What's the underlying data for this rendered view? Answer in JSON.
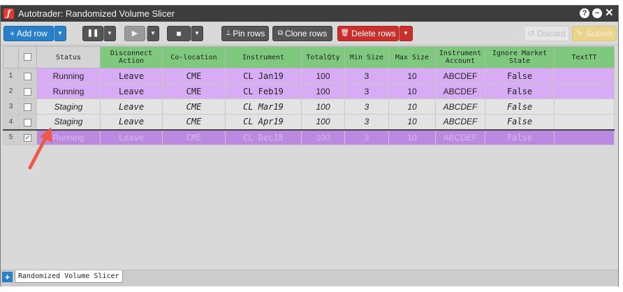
{
  "window": {
    "title": "Autotrader: Randomized Volume Slicer"
  },
  "titlebar": {
    "help_icon": "?",
    "minimize_icon": "−",
    "close_icon": "✕"
  },
  "toolbar": {
    "add_row": "+ Add row",
    "pin_rows": "Pin rows",
    "clone_rows": "Clone rows",
    "delete_rows": "Delete rows",
    "discard": "Discard",
    "submit": "Submit"
  },
  "grid": {
    "columns": [
      "Status",
      "Disconnect Action",
      "Co-location",
      "Instrument",
      "TotalQty",
      "Min Size",
      "Max Size",
      "Instrument Account",
      "Ignore Market State",
      "TextTT"
    ],
    "rows": [
      {
        "num": "1",
        "checked": "",
        "status": "Running",
        "disconnect": "Leave",
        "colocation": "CME",
        "instrument": "CL Jan19",
        "totalqty": "100",
        "min": "3",
        "max": "10",
        "account": "ABCDEF",
        "ignore": "False",
        "text": ""
      },
      {
        "num": "2",
        "checked": "",
        "status": "Running",
        "disconnect": "Leave",
        "colocation": "CME",
        "instrument": "CL Feb19",
        "totalqty": "100",
        "min": "3",
        "max": "10",
        "account": "ABCDEF",
        "ignore": "False",
        "text": ""
      },
      {
        "num": "3",
        "checked": "",
        "status": "Staging",
        "disconnect": "Leave",
        "colocation": "CME",
        "instrument": "CL Mar19",
        "totalqty": "100",
        "min": "3",
        "max": "10",
        "account": "ABCDEF",
        "ignore": "False",
        "text": ""
      },
      {
        "num": "4",
        "checked": "",
        "status": "Staging",
        "disconnect": "Leave",
        "colocation": "CME",
        "instrument": "CL Apr19",
        "totalqty": "100",
        "min": "3",
        "max": "10",
        "account": "ABCDEF",
        "ignore": "False",
        "text": ""
      },
      {
        "num": "5",
        "checked": "✓",
        "status": "Running",
        "disconnect": "Leave",
        "colocation": "CME",
        "instrument": "CL Dec18",
        "totalqty": "100",
        "min": "3",
        "max": "10",
        "account": "ABCDEF",
        "ignore": "False",
        "text": ""
      }
    ]
  },
  "tabs": {
    "add_icon": "+",
    "active": "Randomized Volume Slicer"
  },
  "colors": {
    "running": "#d8acf5",
    "staging": "#e3e3e3",
    "selected": "#bc89e0",
    "header_green": "#7fc97f",
    "accent": "#2a7fc9",
    "danger": "#c9302c",
    "arrow": "#ee5a4a"
  }
}
